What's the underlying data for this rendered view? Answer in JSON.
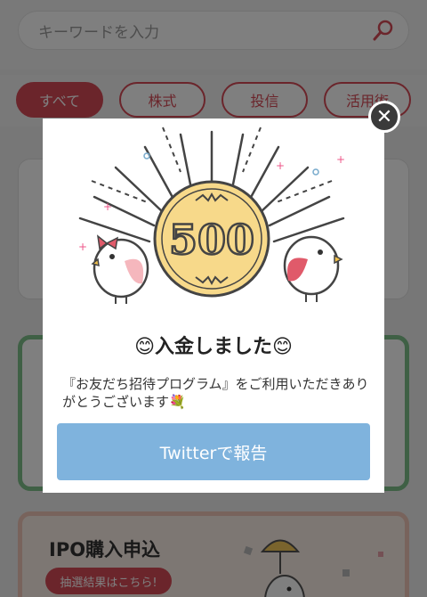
{
  "search": {
    "placeholder": "キーワードを入力",
    "icon": "search-icon"
  },
  "filters": [
    {
      "label": "すべて",
      "active": true
    },
    {
      "label": "株式",
      "active": false
    },
    {
      "label": "投信",
      "active": false
    },
    {
      "label": "活用術",
      "active": false
    }
  ],
  "promo": {
    "title": "IPO購入申込",
    "badge": "抽選結果はこちら!"
  },
  "modal": {
    "coin_amount": "500",
    "title": "😊入金しました😊",
    "body": "『お友だち招待プログラム』をご利用いただきありがとうございます💐",
    "button_label": "Twitterで報告",
    "close_glyph": "✕"
  },
  "colors": {
    "accent": "#d64b57",
    "twitter": "#7fb3dd",
    "card_green": "#7fc08a"
  }
}
